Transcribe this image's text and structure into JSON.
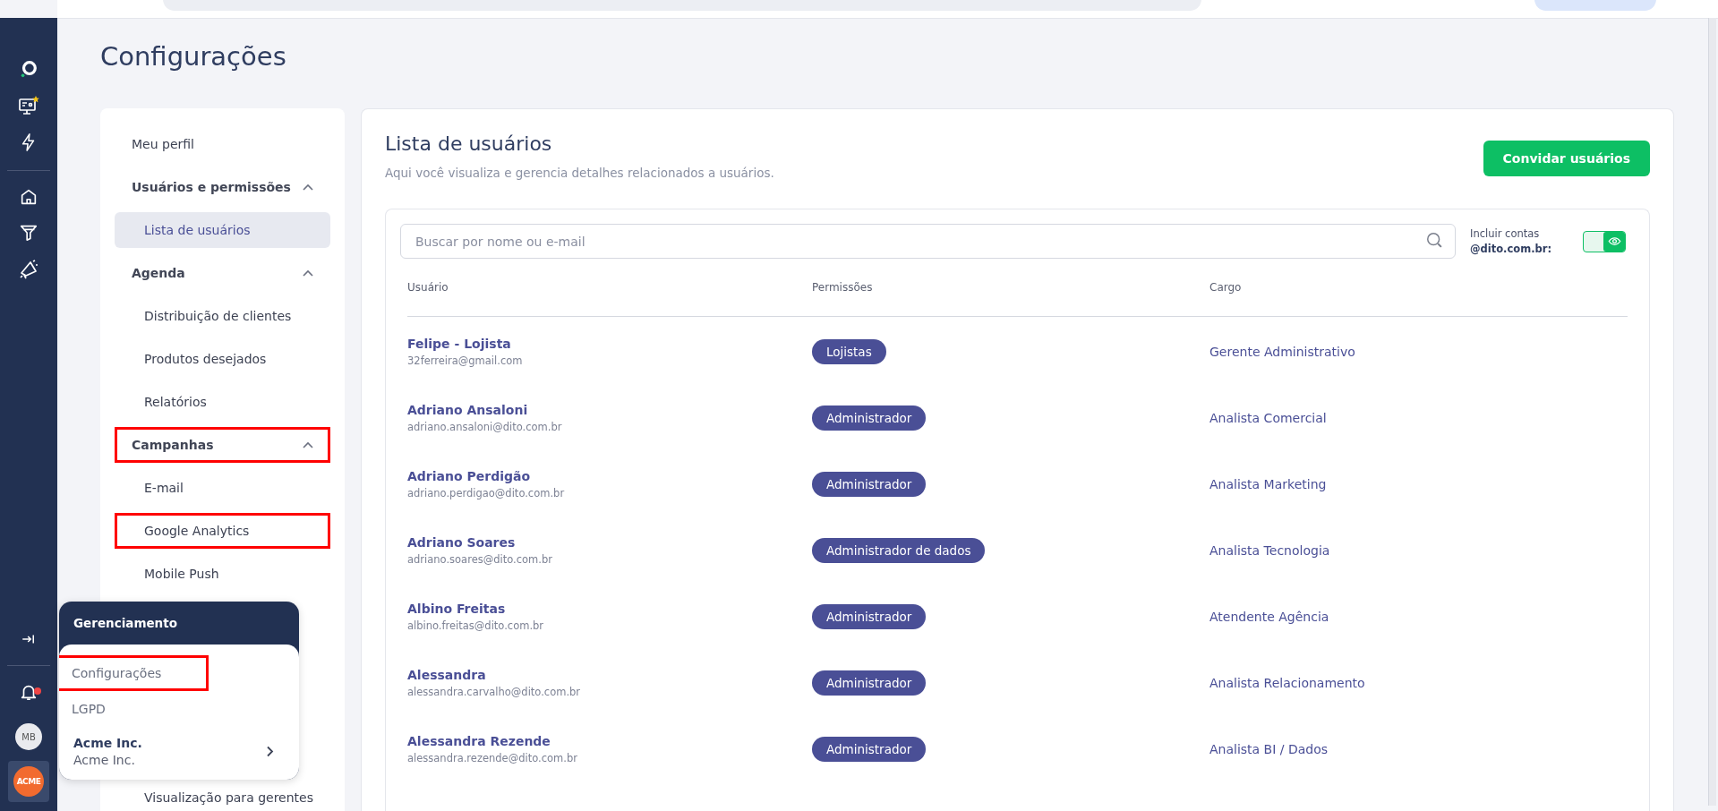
{
  "page": {
    "title": "Configurações"
  },
  "rail": {
    "notification_dot": true,
    "avatar": "MB",
    "logo": "ACME"
  },
  "sidebar": {
    "items": [
      {
        "kind": "link",
        "label": "Meu perfil",
        "selected": false,
        "highlighted": false
      },
      {
        "kind": "section",
        "label": "Usuários e permissões",
        "expanded": true,
        "highlighted": false,
        "children": [
          {
            "label": "Lista de usuários",
            "selected": true,
            "highlighted": false
          }
        ]
      },
      {
        "kind": "section",
        "label": "Agenda",
        "expanded": true,
        "highlighted": false,
        "children": [
          {
            "label": "Distribuição de clientes",
            "selected": false,
            "highlighted": false
          },
          {
            "label": "Produtos desejados",
            "selected": false,
            "highlighted": false
          },
          {
            "label": "Relatórios",
            "selected": false,
            "highlighted": false
          }
        ]
      },
      {
        "kind": "section",
        "label": "Campanhas",
        "expanded": true,
        "highlighted": true,
        "children": [
          {
            "label": "E-mail",
            "selected": false,
            "highlighted": false
          },
          {
            "label": "Google Analytics",
            "selected": false,
            "highlighted": true
          },
          {
            "label": "Mobile Push",
            "selected": false,
            "highlighted": false
          }
        ]
      }
    ],
    "bottom_item": {
      "label": "Visualização para gerentes"
    }
  },
  "popup": {
    "title": "Gerenciamento",
    "items": [
      {
        "label": "Configurações",
        "highlighted": true
      },
      {
        "label": "LGPD",
        "highlighted": false
      }
    ],
    "account": {
      "name": "Acme Inc.",
      "subtitle": "Acme Inc."
    }
  },
  "main": {
    "title": "Lista de usuários",
    "subtitle": "Aqui você visualiza e gerencia detalhes relacionados a usuários.",
    "invite_button": "Convidar usuários",
    "search": {
      "placeholder": "Buscar por nome ou e-mail"
    },
    "toggle": {
      "label": "Incluir contas",
      "domain": "@dito.com.br:",
      "on": true
    },
    "table": {
      "columns": [
        "Usuário",
        "Permissões",
        "Cargo"
      ],
      "rows": [
        {
          "name": "Felipe - Lojista",
          "email": "32ferreira@gmail.com",
          "permission": "Lojistas",
          "role": "Gerente Administrativo"
        },
        {
          "name": "Adriano Ansaloni",
          "email": "adriano.ansaloni@dito.com.br",
          "permission": "Administrador",
          "role": "Analista Comercial"
        },
        {
          "name": "Adriano Perdigão",
          "email": "adriano.perdigao@dito.com.br",
          "permission": "Administrador",
          "role": "Analista Marketing"
        },
        {
          "name": "Adriano Soares",
          "email": "adriano.soares@dito.com.br",
          "permission": "Administrador de dados",
          "role": "Analista Tecnologia"
        },
        {
          "name": "Albino Freitas",
          "email": "albino.freitas@dito.com.br",
          "permission": "Administrador",
          "role": "Atendente Agência"
        },
        {
          "name": "Alessandra",
          "email": "alessandra.carvalho@dito.com.br",
          "permission": "Administrador",
          "role": "Analista Relacionamento"
        },
        {
          "name": "Alessandra Rezende",
          "email": "alessandra.rezende@dito.com.br",
          "permission": "Administrador",
          "role": "Analista BI / Dados"
        }
      ]
    }
  }
}
